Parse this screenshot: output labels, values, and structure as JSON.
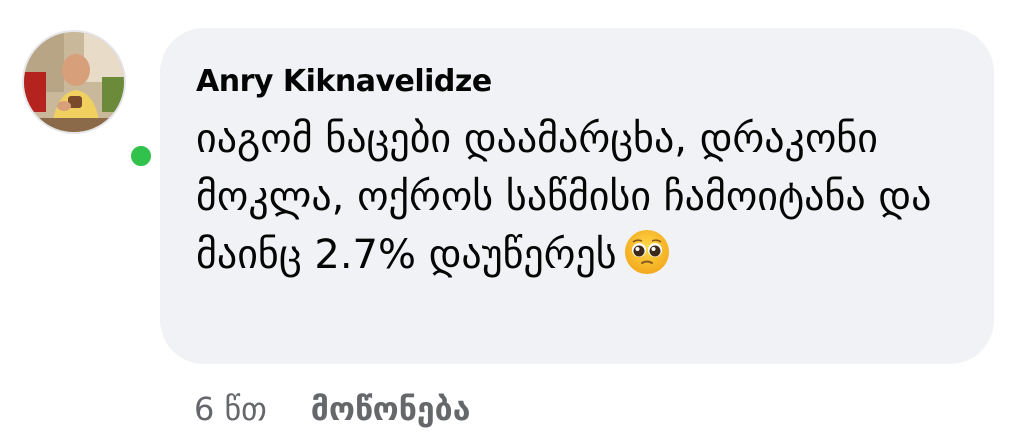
{
  "comment": {
    "author": "Anry Kiknavelidze",
    "text": "იაგომ ნაცები დაამარცხა, დრაკონი მოკლა, ოქროს საწმისი ჩამოიტანა და მაინც 2.7% დაუწერეს",
    "emoji": "pleading-face-emoji",
    "online": true
  },
  "actions": {
    "time": "6 წთ",
    "like_label": "მოწონება"
  },
  "colors": {
    "bubble": "#f0f2f5",
    "online": "#31c24d",
    "secondary_text": "#65676b"
  }
}
